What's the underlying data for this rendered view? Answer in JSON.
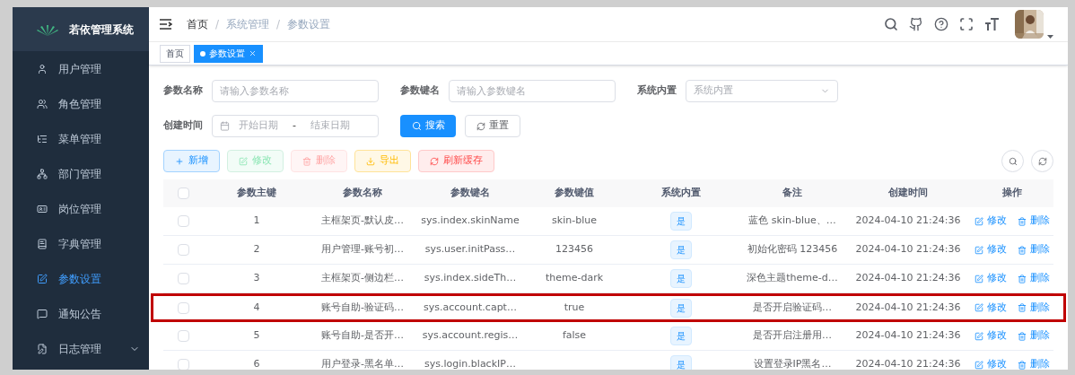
{
  "sidebar": {
    "title": "若依管理系统",
    "items": [
      {
        "label": "用户管理",
        "selected": false,
        "has_children": false
      },
      {
        "label": "角色管理",
        "selected": false,
        "has_children": false
      },
      {
        "label": "菜单管理",
        "selected": false,
        "has_children": false
      },
      {
        "label": "部门管理",
        "selected": false,
        "has_children": false
      },
      {
        "label": "岗位管理",
        "selected": false,
        "has_children": false
      },
      {
        "label": "字典管理",
        "selected": false,
        "has_children": false
      },
      {
        "label": "参数设置",
        "selected": true,
        "has_children": false
      },
      {
        "label": "通知公告",
        "selected": false,
        "has_children": false
      },
      {
        "label": "日志管理",
        "selected": false,
        "has_children": true
      }
    ]
  },
  "breadcrumb": {
    "separator": "/",
    "items": [
      "首页",
      "系统管理",
      "参数设置"
    ]
  },
  "tags": [
    {
      "label": "首页",
      "selected": false,
      "closable": false
    },
    {
      "label": "参数设置",
      "selected": true,
      "closable": true
    }
  ],
  "filters": [
    {
      "label": "参数名称",
      "kind": "text",
      "placeholder": "请输入参数名称"
    },
    {
      "label": "参数键名",
      "kind": "text",
      "placeholder": "请输入参数键名"
    },
    {
      "label": "系统内置",
      "kind": "select",
      "placeholder": "系统内置"
    }
  ],
  "date_filter": {
    "label": "创建时间",
    "start_placeholder": "开始日期",
    "separator": "-",
    "end_placeholder": "结束日期"
  },
  "search_button": "搜索",
  "reset_button": "重置",
  "toolbar": [
    {
      "label": "新增",
      "kind": "add",
      "disabled": false
    },
    {
      "label": "修改",
      "kind": "edit",
      "disabled": true
    },
    {
      "label": "删除",
      "kind": "delete",
      "disabled": true
    },
    {
      "label": "导出",
      "kind": "export",
      "disabled": false
    },
    {
      "label": "刷新缓存",
      "kind": "refresh",
      "disabled": false
    }
  ],
  "table": {
    "header_checked": false,
    "columns": [
      "参数主键",
      "参数名称",
      "参数键名",
      "参数键值",
      "系统内置",
      "备注",
      "创建时间",
      "操作"
    ],
    "rows": [
      {
        "id": "1",
        "name": "主框架页-默认皮…",
        "key": "sys.index.skinName",
        "value": "skin-blue",
        "builtin": "是",
        "remark": "蓝色 skin-blue、…",
        "created": "2024-04-10 21:24:36",
        "actions": [
          "修改",
          "删除"
        ],
        "checked": false,
        "outlined": false
      },
      {
        "id": "2",
        "name": "用户管理-账号初…",
        "key": "sys.user.initPass…",
        "value": "123456",
        "builtin": "是",
        "remark": "初始化密码 123456",
        "created": "2024-04-10 21:24:36",
        "actions": [
          "修改",
          "删除"
        ],
        "checked": false,
        "outlined": false
      },
      {
        "id": "3",
        "name": "主框架页-侧边栏…",
        "key": "sys.index.sideTh…",
        "value": "theme-dark",
        "builtin": "是",
        "remark": "深色主题theme-d…",
        "created": "2024-04-10 21:24:36",
        "actions": [
          "修改",
          "删除"
        ],
        "checked": false,
        "outlined": false
      },
      {
        "id": "4",
        "name": "账号自助-验证码…",
        "key": "sys.account.capt…",
        "value": "true",
        "builtin": "是",
        "remark": "是否开启验证码…",
        "created": "2024-04-10 21:24:36",
        "actions": [
          "修改",
          "删除"
        ],
        "checked": false,
        "outlined": true
      },
      {
        "id": "5",
        "name": "账号自助-是否开…",
        "key": "sys.account.regis…",
        "value": "false",
        "builtin": "是",
        "remark": "是否开启注册用…",
        "created": "2024-04-10 21:24:36",
        "actions": [
          "修改",
          "删除"
        ],
        "checked": false,
        "outlined": false
      },
      {
        "id": "6",
        "name": "用户登录-黑名单…",
        "key": "sys.login.blackIP…",
        "builtin": "是",
        "remark": "设置登录IP黑名…",
        "created": "2024-04-10 21:24:36",
        "actions": [
          "修改",
          "删除"
        ],
        "checked": false,
        "outlined": false
      }
    ]
  }
}
